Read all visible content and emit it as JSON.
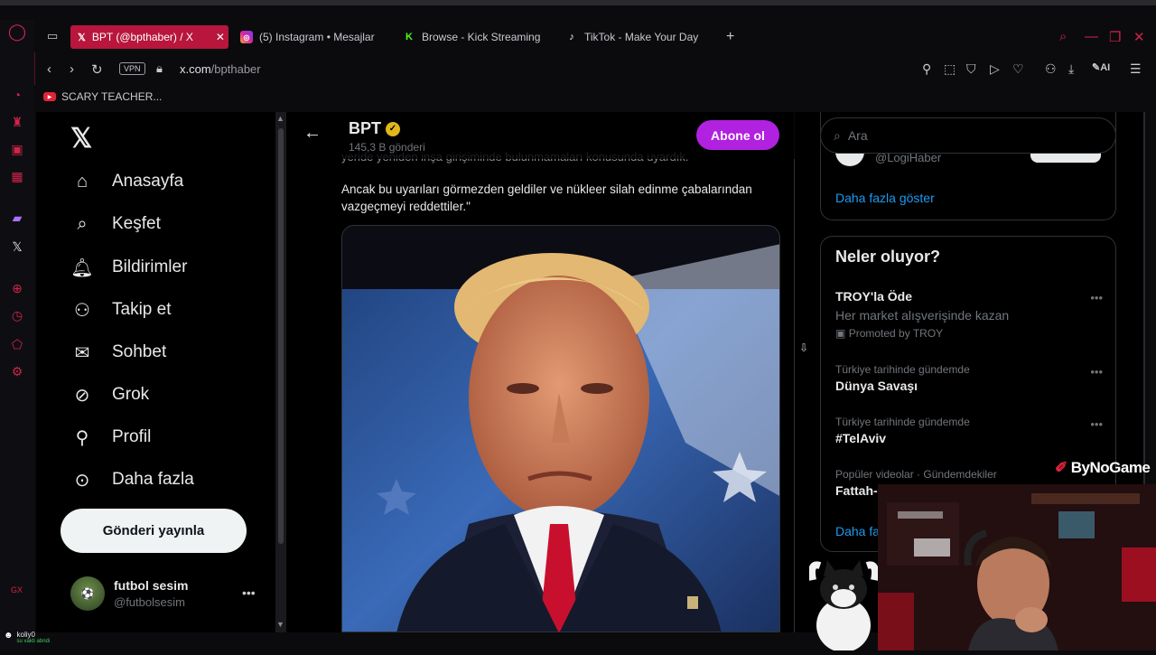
{
  "browser": {
    "tabs": [
      {
        "label": "BPT (@bpthaber) / X",
        "icon": "x-logo-icon",
        "active": true
      },
      {
        "label": "(5) Instagram • Mesajlar",
        "icon": "instagram-icon",
        "active": false
      },
      {
        "label": "Browse - Kick Streaming",
        "icon": "kick-icon",
        "active": false
      },
      {
        "label": "TikTok - Make Your Day",
        "icon": "tiktok-icon",
        "active": false
      }
    ],
    "vpn_label": "VPN",
    "url_host": "x.com",
    "url_path": "/bpthaber",
    "ai_label": "AI",
    "bookmark": "SCARY TEACHER...",
    "accent": "#d0244a"
  },
  "sidebar": {
    "items": [
      {
        "label": "Anasayfa",
        "icon": "home-icon"
      },
      {
        "label": "Keşfet",
        "icon": "search-icon"
      },
      {
        "label": "Bildirimler",
        "icon": "bell-icon"
      },
      {
        "label": "Takip et",
        "icon": "follow-icon"
      },
      {
        "label": "Sohbet",
        "icon": "mail-icon"
      },
      {
        "label": "Grok",
        "icon": "grok-icon"
      },
      {
        "label": "Profil",
        "icon": "profile-icon"
      },
      {
        "label": "Daha fazla",
        "icon": "more-icon"
      }
    ],
    "post_button": "Gönderi yayınla",
    "account": {
      "name": "futbol sesim",
      "handle": "@futbolsesim"
    }
  },
  "profile_header": {
    "name": "BPT",
    "posts_count": "145,3 B gönderi",
    "subscribe_button": "Abone ol"
  },
  "post": {
    "cut_text": "yeride yeniden inşa girişiminde bulunmamaları konusunda uyardık.",
    "text": "Ancak bu uyarıları görmezden geldiler ve nükleer silah edinme çabalarından vazgeçmeyi reddettiler.\""
  },
  "right": {
    "search_placeholder": "Ara",
    "who_to_follow_cut": "@LogiHaber",
    "show_more": "Daha fazla göster",
    "trends_title": "Neler oluyor?",
    "trends": [
      {
        "context": "",
        "name": "TROY'la Öde",
        "desc": "Her market alışverişinde kazan",
        "promo": "Promoted by TROY"
      },
      {
        "context": "Türkiye tarihinde gündemde",
        "name": "Dünya Savaşı"
      },
      {
        "context": "Türkiye tarihinde gündemde",
        "name": "#TelAviv"
      },
      {
        "context": "Popüler videolar · Gündemdekiler",
        "name": "Fattah-"
      }
    ],
    "show_more_2": "Daha fa"
  },
  "overlay": {
    "brand": "ByNoGame",
    "notif_name": "koliy0",
    "notif_sub": "su vakti abndi"
  }
}
